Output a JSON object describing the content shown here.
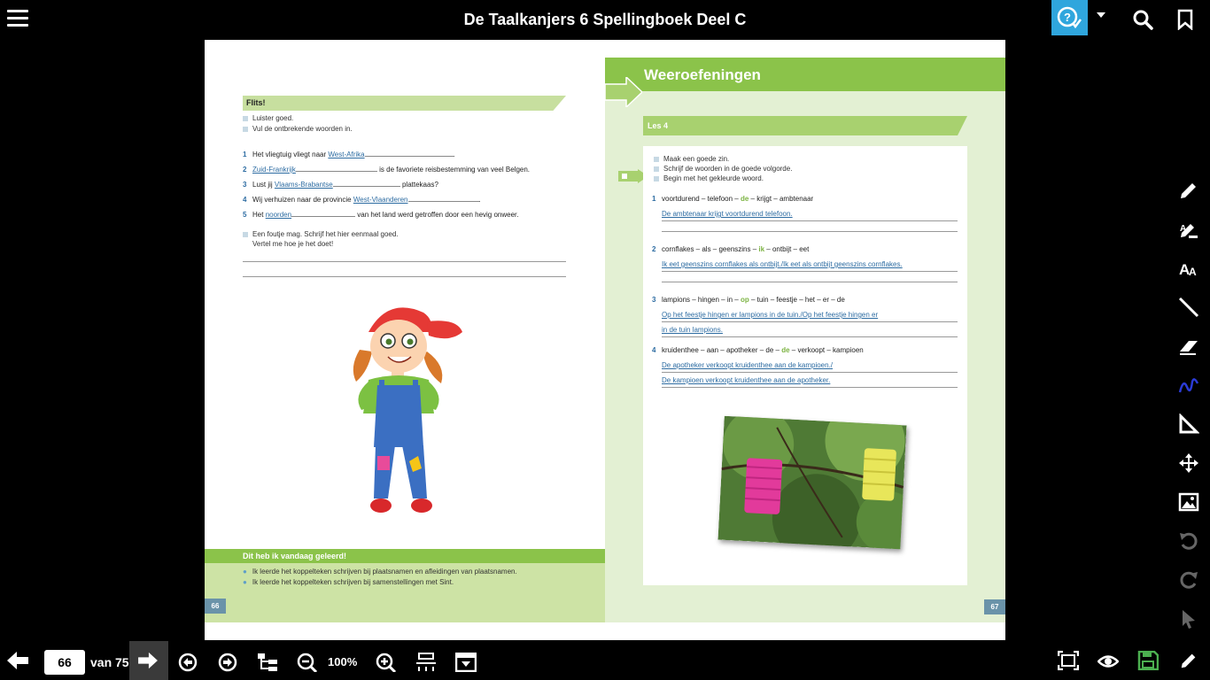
{
  "header": {
    "title": "De Taalkanjers 6 Spellingboek Deel C"
  },
  "left_page": {
    "flits_title": "Flits!",
    "instructions": [
      "Luister goed.",
      "Vul de ontbrekende woorden in."
    ],
    "exercises": [
      {
        "num": "1",
        "before": "Het vliegtuig vliegt naar",
        "answer": "West-Afrika",
        "after": "."
      },
      {
        "num": "2",
        "before": "",
        "answer": "Zuid-Frankrijk",
        "after": "is de favoriete reisbestemming van veel Belgen."
      },
      {
        "num": "3",
        "before": "Lust jij",
        "answer": "Vlaams-Brabantse",
        "after": "plattekaas?"
      },
      {
        "num": "4",
        "before": "Wij verhuizen naar de provincie",
        "answer": "West-Vlaanderen",
        "after": "."
      },
      {
        "num": "5",
        "before": "Het",
        "answer": "noorden",
        "after": "van het land werd getroffen door een hevig onweer."
      }
    ],
    "note_line1": "Een foutje mag. Schrijf het hier eenmaal goed.",
    "note_line2": "Vertel me hoe je het doet!",
    "learned_title": "Dit heb ik vandaag geleerd!",
    "learned_items": [
      "Ik leerde het koppelteken schrijven bij plaatsnamen en afleidingen van plaatsnamen.",
      "Ik leerde het koppelteken schrijven bij samenstellingen met Sint."
    ],
    "page_number": "66"
  },
  "right_page": {
    "banner_title": "Weeroefeningen",
    "lesson": "Les 4",
    "instructions": [
      "Maak een goede zin.",
      "Schrijf de woorden in de goede volgorde.",
      "Begin met het gekleurde woord."
    ],
    "questions": [
      {
        "num": "1",
        "pre": "voortdurend – telefoon – ",
        "hl": "de",
        "post": " – krijgt – ambtenaar",
        "answers": [
          "De ambtenaar krijgt voortdurend telefoon."
        ]
      },
      {
        "num": "2",
        "pre": "cornflakes – als – geenszins – ",
        "hl": "ik",
        "post": " – ontbijt – eet",
        "answers": [
          "Ik eet geenszins cornflakes als ontbijt./Ik eet als ontbijt geenszins cornflakes."
        ]
      },
      {
        "num": "3",
        "pre": "lampions – hingen – in – ",
        "hl": "op",
        "post": " – tuin – feestje – het – er – de",
        "answers": [
          "Op het feestje hingen er lampions in de tuin./Op het feestje hingen er",
          "in de tuin lampions."
        ]
      },
      {
        "num": "4",
        "pre": "kruidenthee – aan – apotheker – de – ",
        "hl": "de",
        "post": " – verkoopt – kampioen",
        "answers": [
          "De apotheker verkoopt kruidenthee aan de kampioen./",
          "De kampioen verkoopt kruidenthee aan de apotheker."
        ]
      }
    ],
    "page_number": "67"
  },
  "footer": {
    "current_page": "66",
    "total_label": "van 75",
    "zoom": "100%"
  },
  "colors": {
    "accent_green": "#8bc34a",
    "help_blue": "#2fa6dd",
    "answer_blue": "#2d6ca2"
  }
}
